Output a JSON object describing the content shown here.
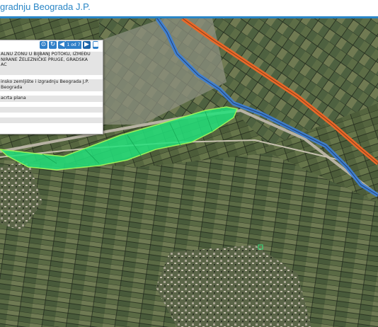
{
  "header": {
    "title": "gradnju Beograda J.P."
  },
  "info_panel": {
    "counter": "1 od 7",
    "plan_title_lines": [
      "ALNU ZONU U BIJBANJ POTOKU, IZMEĐU",
      "NIRANE ŽELEZNIČKE PRUGE, GRADSKA",
      "AC"
    ],
    "authority_lines": [
      "insko zemljište i izgradnju Beograda J.P.",
      "Beograda"
    ],
    "link_label": "acrta plana"
  },
  "map": {
    "colors": {
      "plan_area_fill": "#22e07a",
      "plan_area_stroke": "#9cf05a",
      "river": "#3d7fd6",
      "highway": "#e8692a",
      "parcel_lines": "#1a1f17"
    }
  }
}
